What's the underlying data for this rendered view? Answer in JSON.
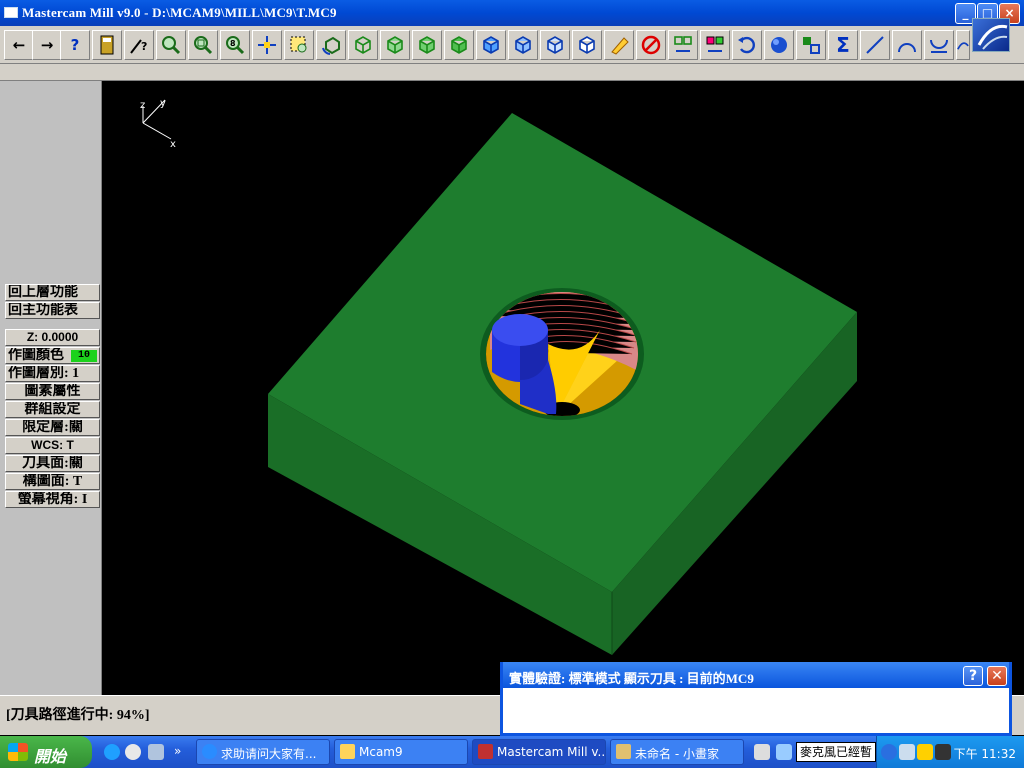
{
  "window": {
    "title": "Mastercam Mill v9.0 - D:\\MCAM9\\MILL\\MC9\\T.MC9",
    "controls": {
      "minimize": "_",
      "maximize": "□",
      "close": "×"
    }
  },
  "toolbar": {
    "buttons": [
      "back-arrow-icon",
      "forward-arrow-icon",
      "help-icon",
      "calculator-icon",
      "analyze-icon",
      "zoom-window-icon",
      "zoom-out-icon",
      "zoom-scale-icon",
      "pan-icon",
      "select-window-icon",
      "rotate-view-icon",
      "view-top-icon",
      "view-front-icon",
      "view-side-icon",
      "view-iso-icon",
      "cube-view-1-icon",
      "cube-view-2-icon",
      "cube-view-3-icon",
      "cube-view-4-icon",
      "eraser-icon",
      "delete-icon",
      "transform-icon",
      "group-icon",
      "undo-icon",
      "shade-icon",
      "copy-icon",
      "sigma-icon",
      "line-icon",
      "arc-icon",
      "fillet-icon",
      "spline-icon"
    ],
    "labels": {
      "help": "?",
      "sigma": "Σ"
    }
  },
  "left_menu": {
    "items": [
      "回上層功能",
      "回主功能表",
      "Z:  0.0000",
      "作圖顏色",
      "作圖層別:  1",
      "圖素屬性",
      "群組設定",
      "限定層:關",
      "WCS:   T",
      "刀具面:關",
      "構圖面:  T",
      "螢幕視角:  I"
    ],
    "color_value": "10"
  },
  "viewport": {
    "axes": {
      "x": "x",
      "y": "y",
      "z": "z"
    },
    "colors": {
      "block": "#1d7a2c",
      "pocket_wall": "#e6b800",
      "tool": "#2233dd",
      "toolpath": "#e07070",
      "background": "#000000"
    }
  },
  "status": {
    "text": "[刀具路徑進行中:   94%]"
  },
  "verify_window": {
    "title": "實體驗證: 標準模式 顯示刀具 : 目前的MC9",
    "help": "?",
    "close": "✕"
  },
  "taskbar": {
    "start_label": "開始",
    "tasks": [
      "求助请问大家有...",
      "Mcam9",
      "Mastercam Mill v...",
      "未命名 - 小畫家"
    ],
    "ime_text": "麥克風已經暫",
    "clock": "下午 11:32"
  }
}
